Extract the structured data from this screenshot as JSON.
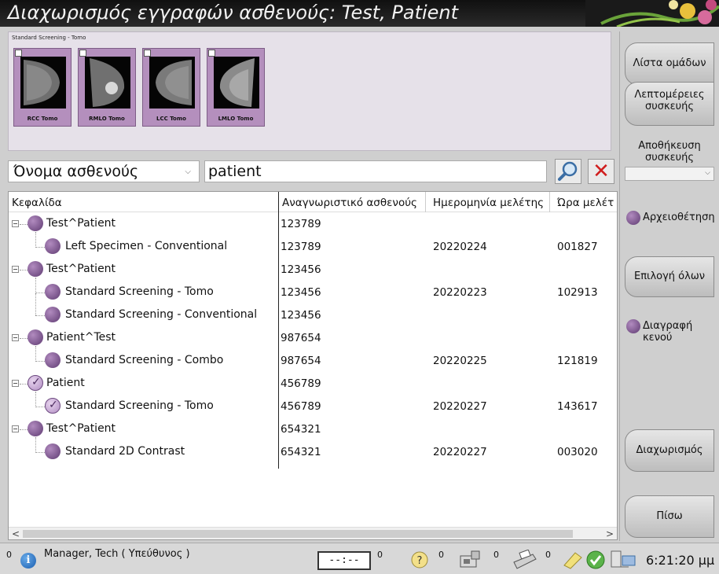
{
  "window": {
    "title": "Διαχωρισμός εγγραφών ασθενούς: Test, Patient"
  },
  "thumbnails": {
    "group_label": "Standard Screening - Tomo",
    "items": [
      {
        "label": "RCC Tomo"
      },
      {
        "label": "RMLO Tomo"
      },
      {
        "label": "LCC Tomo"
      },
      {
        "label": "LMLO Tomo"
      }
    ]
  },
  "search": {
    "field_selected": "Όνομα ασθενούς",
    "query": "patient"
  },
  "table": {
    "columns": [
      "Κεφαλίδα",
      "Αναγνωριστικό ασθενούς",
      "Ημερομηνία μελέτης",
      "Ώρα μελέτ"
    ],
    "rows": [
      {
        "name": "Test^Patient",
        "id": "123789",
        "date": "",
        "time": "",
        "level": 0,
        "checked": false
      },
      {
        "name": "Left Specimen - Conventional",
        "id": "123789",
        "date": "20220224",
        "time": "001827",
        "level": 1,
        "checked": false
      },
      {
        "name": "Test^Patient",
        "id": "123456",
        "date": "",
        "time": "",
        "level": 0,
        "checked": false
      },
      {
        "name": "Standard Screening - Tomo",
        "id": "123456",
        "date": "20220223",
        "time": "102913",
        "level": 1,
        "checked": false
      },
      {
        "name": "Standard Screening - Conventional",
        "id": "123456",
        "date": "",
        "time": "",
        "level": 1,
        "checked": false
      },
      {
        "name": "Patient^Test",
        "id": "987654",
        "date": "",
        "time": "",
        "level": 0,
        "checked": false
      },
      {
        "name": "Standard Screening - Combo",
        "id": "987654",
        "date": "20220225",
        "time": "121819",
        "level": 1,
        "checked": false
      },
      {
        "name": "Patient",
        "id": "456789",
        "date": "",
        "time": "",
        "level": 0,
        "checked": true
      },
      {
        "name": "Standard Screening - Tomo",
        "id": "456789",
        "date": "20220227",
        "time": "143617",
        "level": 1,
        "checked": true
      },
      {
        "name": "Test^Patient",
        "id": "654321",
        "date": "",
        "time": "",
        "level": 0,
        "checked": false
      },
      {
        "name": "Standard 2D Contrast",
        "id": "654321",
        "date": "20220227",
        "time": "003020",
        "level": 1,
        "checked": false
      }
    ]
  },
  "sidebar": {
    "group_list": "Λίστα ομάδων",
    "device_details": "Λεπτομέρειες συσκευής",
    "device_storage": "Αποθήκευση συσκευής",
    "archive": "Αρχειοθέτηση",
    "select_all": "Επιλογή όλων",
    "delete_blank": "Διαγραφή κενού",
    "split": "Διαχωρισμός",
    "back": "Πίσω"
  },
  "status": {
    "left_count": "0",
    "user": "Manager, Tech ( Υπεύθυνος )",
    "timer": "--:--",
    "count_timer": "0",
    "count_help": "0",
    "count_media": "0",
    "count_print": "0",
    "time": "6:21:20 μμ"
  }
}
